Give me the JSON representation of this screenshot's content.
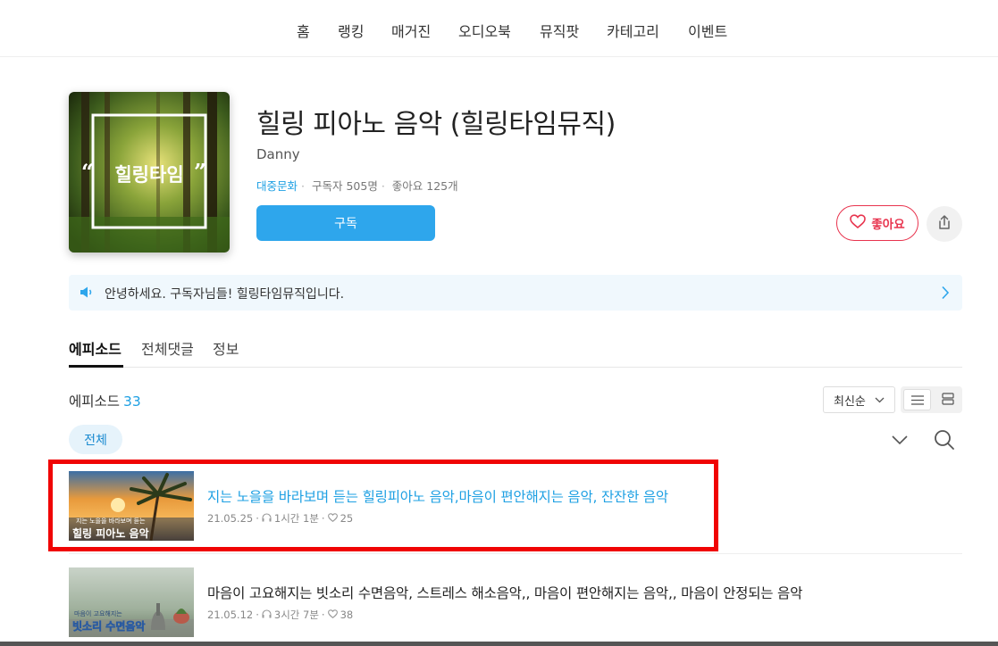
{
  "nav": {
    "items": [
      "홈",
      "랭킹",
      "매거진",
      "오디오북",
      "뮤직팟",
      "카테고리",
      "이벤트"
    ]
  },
  "channel": {
    "cover_text": "힐링타임",
    "title": "힐링 피아노 음악 (힐링타임뮤직)",
    "author": "Danny",
    "category": "대중문화",
    "subscribers": "구독자 505명",
    "likes": "좋아요 125개",
    "subscribe_label": "구독",
    "like_label": "좋아요"
  },
  "notice": {
    "text": "안녕하세요. 구독자님들! 힐링타임뮤직입니다."
  },
  "tabs": [
    {
      "label": "에피소드",
      "active": true
    },
    {
      "label": "전체댓글",
      "active": false
    },
    {
      "label": "정보",
      "active": false
    }
  ],
  "episodes_header": {
    "label": "에피소드",
    "count": "33",
    "sort_label": "최신순",
    "filter_chip": "전체"
  },
  "episodes": [
    {
      "title": "지는 노을을 바라보며 듣는 힐링피아노 음악,마음이 편안해지는 음악, 잔잔한 음악",
      "date": "21.05.25",
      "duration": "1시간 1분",
      "likes": "25",
      "thumb_caption_small": "지는 노을을 바라보며 듣는",
      "thumb_caption_big": "힐링 피아노 음악",
      "highlighted": true
    },
    {
      "title": "마음이 고요해지는 빗소리 수면음악, 스트레스 해소음악,, 마음이 편안해지는 음악,, 마음이 안정되는 음악",
      "date": "21.05.12",
      "duration": "3시간 7분",
      "likes": "38",
      "thumb_caption_small": "마음이 고요해지는",
      "thumb_caption_big": "빗소리 수면음악",
      "highlighted": false
    }
  ],
  "colors": {
    "accent": "#1ea0e3",
    "subscribe": "#2ea6ec",
    "like": "#e8344e",
    "highlight": "#f00404"
  }
}
